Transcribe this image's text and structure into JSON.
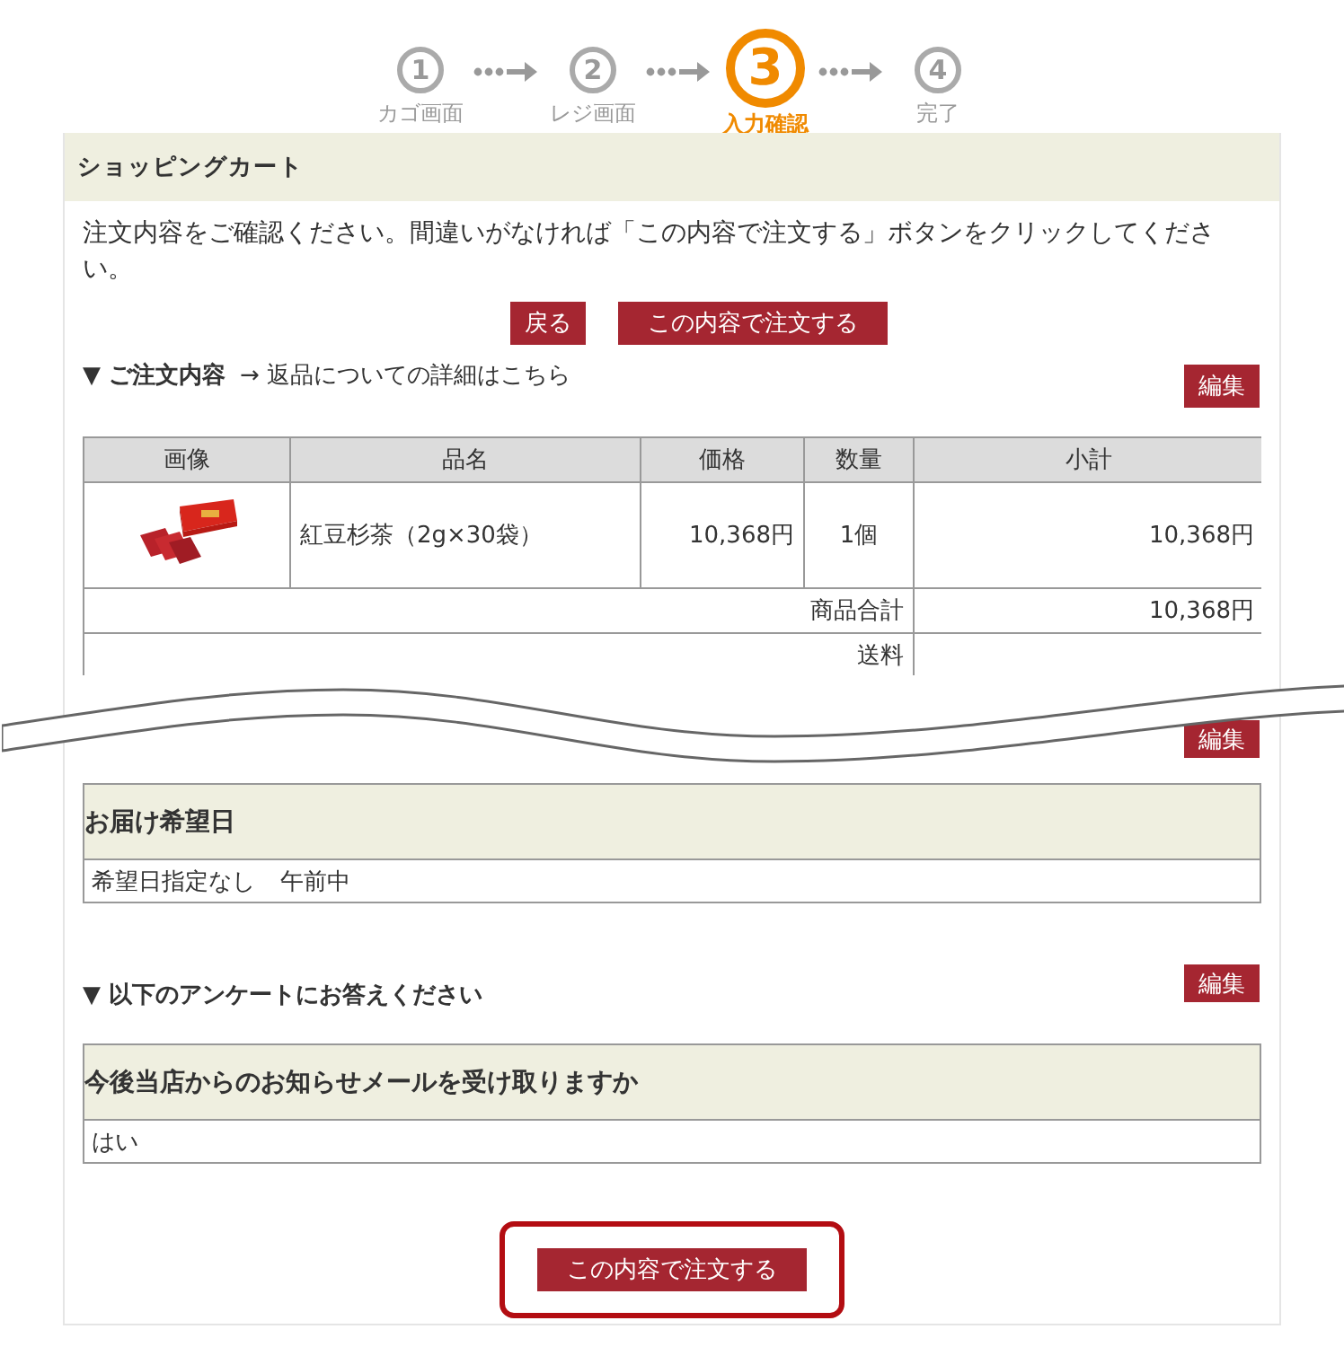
{
  "steps": [
    {
      "number": "1",
      "label": "カゴ画面",
      "selected": false
    },
    {
      "number": "2",
      "label": "レジ画面",
      "selected": false
    },
    {
      "number": "3",
      "label": "入力確認",
      "selected": true
    },
    {
      "number": "4",
      "label": "完了",
      "selected": false
    }
  ],
  "cart": {
    "title": "ショッピングカート",
    "message": "注文内容をご確認ください。間違いがなければ「この内容で注文する」ボタンをクリックしてください。",
    "buttons": [
      {
        "label": "戻る",
        "kind": "back"
      },
      {
        "label": "この内容で注文する",
        "kind": "order"
      }
    ]
  },
  "order_section": {
    "heading": "▼ ご注文内容",
    "link": "→ 返品についての詳細はこちら",
    "edit_button": "編集",
    "table": {
      "columns": [
        "画像",
        "品名",
        "価格",
        "数量",
        "小計"
      ],
      "rows": [
        {
          "name": "紅豆杉茶（2g×30袋）",
          "price": "10,368円",
          "quantity": "1個",
          "subtotal": "10,368円"
        }
      ],
      "summary": [
        {
          "label": "商品合計",
          "value": "10,368円"
        },
        {
          "label": "送料"
        }
      ]
    },
    "edit_button_after_break": "編集"
  },
  "delivery": {
    "heading": "お届け希望日",
    "values": [
      "希望日指定なし",
      "午前中"
    ]
  },
  "survey": {
    "heading": "▼ 以下のアンケートにお答えください",
    "edit_button": "編集",
    "question": "今後当店からのお知らせメールを受け取りますか",
    "answer": "はい"
  },
  "final_button": {
    "label": "この内容で注文する",
    "highlighted": true
  }
}
